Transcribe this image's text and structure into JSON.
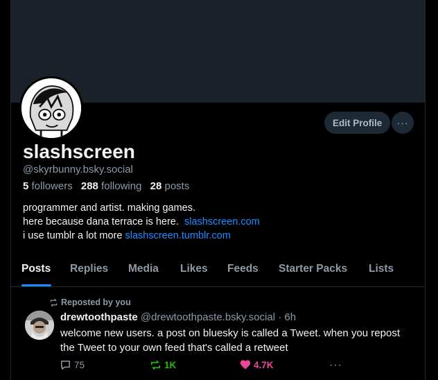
{
  "profile": {
    "display_name": "slashscreen",
    "handle": "@skyrbunny.bsky.social",
    "followers_count": "5",
    "followers_label": "followers",
    "following_count": "288",
    "following_label": "following",
    "posts_count": "28",
    "posts_label": "posts",
    "bio_line1": "programmer and artist. making games.",
    "bio_line2": "here because dana terrace is here.",
    "bio_link1": "slashscreen.com",
    "bio_line3": "i use tumblr a lot more",
    "bio_link2": "slashscreen.tumblr.com",
    "edit_label": "Edit Profile",
    "more_label": "···"
  },
  "tabs": [
    {
      "label": "Posts",
      "active": true
    },
    {
      "label": "Replies"
    },
    {
      "label": "Media"
    },
    {
      "label": "Likes"
    },
    {
      "label": "Feeds"
    },
    {
      "label": "Starter Packs"
    },
    {
      "label": "Lists"
    }
  ],
  "post": {
    "repost_label": "Reposted by you",
    "author": "drewtoothpaste",
    "author_handle": "@drewtoothpaste.bsky.social",
    "time": "· 6h",
    "text": "welcome new users. a post on bluesky is called a Tweet. when you repost the Tweet to your own feed that's called a retweet",
    "reply_count": "75",
    "repost_count": "1K",
    "like_count": "4.7K",
    "menu_label": "···"
  },
  "icons": {
    "repost": "repost-icon",
    "reply": "reply-icon",
    "like": "heart-icon"
  },
  "colors": {
    "accent": "#208bfe",
    "repost_active": "#20bc07",
    "like_active": "#ec4899"
  }
}
